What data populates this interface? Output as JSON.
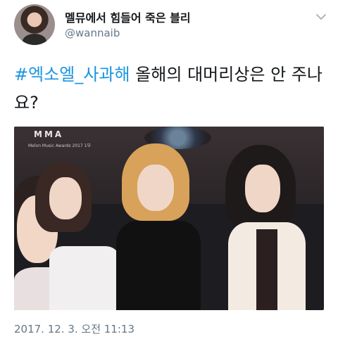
{
  "tweet": {
    "display_name": "멜뮤에서 힘들어 죽은 블리",
    "handle": "@wannaib",
    "hashtag": "#엑소엘_사과해",
    "text_rest": " 올해의 대머리상은 안 주나요?",
    "timestamp": "2017. 12. 3. 오전 11:13"
  },
  "media": {
    "brand_logo_text": "MMA",
    "brand_subtitle": "Melon Music Awards 2017 1부"
  },
  "icons": {
    "menu": "chevron-down-icon"
  },
  "colors": {
    "hashtag": "#1b95e0",
    "secondary_text": "#657786",
    "primary_text": "#14171a"
  }
}
